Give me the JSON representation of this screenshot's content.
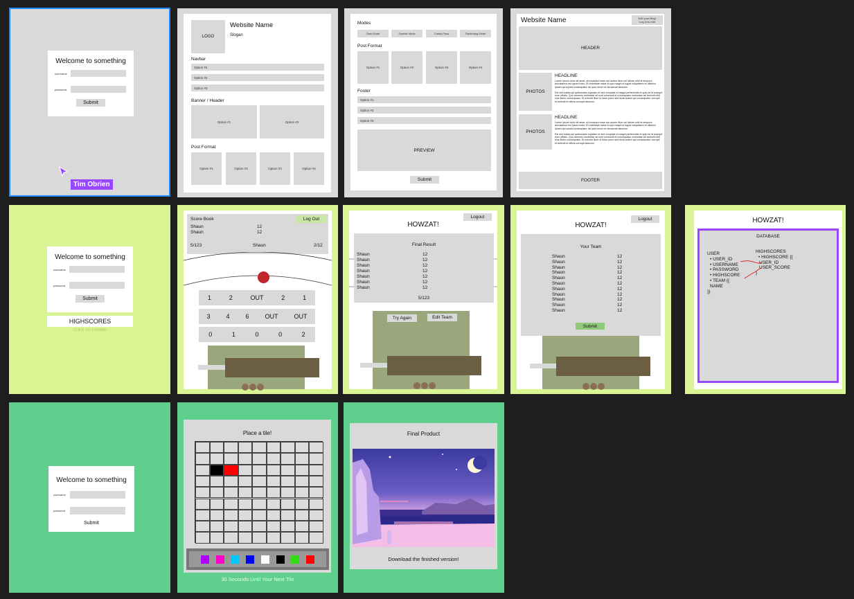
{
  "login": {
    "title": "Welcome to something",
    "username_label": "username",
    "password_label": "password",
    "submit": "Submit"
  },
  "cursor": {
    "user_name": "Tim Obrien",
    "tag_color": "#9747ff"
  },
  "builder": {
    "logo": "LOGO",
    "site_name": "Website Name",
    "slogan": "Slogan",
    "navbar_heading": "Navbar",
    "nav_options": [
      "Option #1",
      "Option #2",
      "Option #3"
    ],
    "banner_heading": "Banner / Header",
    "banner_options": [
      "Option #1",
      "Option #2"
    ],
    "post_heading": "Post Format",
    "post_options": [
      "Option #1",
      "Option #2",
      "Option #3",
      "Option #4"
    ]
  },
  "builder2": {
    "modes_heading": "Modes",
    "modes": [
      "Dark Mode",
      "Zombie Mode",
      "Candy Pass",
      "Flashbang Mode"
    ],
    "post_heading": "Post Format",
    "post_options": [
      "Option #1",
      "Option #2",
      "Option #3",
      "Option #4"
    ],
    "footer_heading": "Footer",
    "footer_options": [
      "Option #1",
      "Option #2",
      "Option #3"
    ],
    "preview": "PREVIEW",
    "submit": "Submit"
  },
  "website": {
    "name": "Website Name",
    "edit_line1": "Edit your Blog!",
    "edit_line2": "Log in to edit",
    "header": "HEADER",
    "photos": "PHOTOS",
    "headline": "HEADLINE",
    "paragraph1": "Lorem ipsum dolor sit amet, sit excepturi esse aut autem illum vel labore nihil et tempore accusamus est ipsum iusto. Et molestiae natus id quo magni ut fugiat voluptatem et ullamco ipsam qui soluta consequatur hic quis rerum et obcaecati laborum.",
    "paragraph2": "Est sint soluta qui quibusdam cupidam et sed voluptate et magni perferendis et quis ea id suscipit eum officiis. Quo cimenes molestiae sit sunt commodi et consequatur molestiae vel deleniti nihil eius libero consequatur. Et eveniet illum id dolor porro sed dicta autem qui consequatur corrupti et deleniti et officia corrupti laborum.",
    "footer": "FOOTER"
  },
  "highscores": {
    "label": "HIGHSCORES",
    "expand": "CLICK TO EXPAND"
  },
  "scorebook": {
    "title": "Score Book",
    "logout": "Log Out",
    "players": [
      {
        "name": "Shaun",
        "score": "12"
      },
      {
        "name": "Shaun",
        "score": "12"
      }
    ],
    "overs": "5/123",
    "batter": "Shaun",
    "wickets": "2/12",
    "grid": [
      [
        "1",
        "2",
        "OUT",
        "2",
        "1"
      ],
      [
        "3",
        "4",
        "6",
        "OUT",
        "OUT"
      ],
      [
        "0",
        "1",
        "0",
        "0",
        "2"
      ]
    ]
  },
  "result": {
    "app_title": "HOWZAT!",
    "logout": "Logout",
    "heading": "Final Result",
    "rows": [
      {
        "name": "Shaun",
        "score": "12"
      },
      {
        "name": "Shaun",
        "score": "12"
      },
      {
        "name": "Shaun",
        "score": "12"
      },
      {
        "name": "Shaun",
        "score": "12"
      },
      {
        "name": "Shaun",
        "score": "12"
      },
      {
        "name": "Shaun",
        "score": "12"
      },
      {
        "name": "Shaun",
        "score": "12"
      }
    ],
    "total": "5/123",
    "try_again": "Try Again",
    "edit_team": "Edit Team"
  },
  "team": {
    "app_title": "HOWZAT!",
    "logout": "Logout",
    "heading": "Your Team",
    "rows": [
      {
        "name": "Shaun",
        "score": "12"
      },
      {
        "name": "Shaun",
        "score": "12"
      },
      {
        "name": "Shaun",
        "score": "12"
      },
      {
        "name": "Shaun",
        "score": "12"
      },
      {
        "name": "Shaun",
        "score": "12"
      },
      {
        "name": "Shaun",
        "score": "12"
      },
      {
        "name": "Shaun",
        "score": "12"
      },
      {
        "name": "Shaun",
        "score": "12"
      },
      {
        "name": "Shaun",
        "score": "12"
      },
      {
        "name": "Shaun",
        "score": "12"
      },
      {
        "name": "Shaun",
        "score": "12"
      }
    ],
    "submit": "Submit",
    "submit_color": "#8fc97a"
  },
  "database": {
    "app_title": "HOWZAT!",
    "heading": "DATABASE",
    "user": "USER",
    "user_fields": [
      "USER_ID",
      "USERNAME",
      "PASSWORD",
      "HIGHSCORE",
      "TEAM {{"
    ],
    "user_name_line": "NAME",
    "user_close": "}}",
    "highscores": "HIGHSCORES",
    "hs_fields": [
      "HIGHSCORE {{"
    ],
    "hs_sub": [
      "USER_ID",
      "USER_SCORE"
    ],
    "hs_close": "}",
    "border_color": "#9747ff"
  },
  "tile": {
    "title": "Place a tile!",
    "palette": [
      "#b000ff",
      "#ff00c8",
      "#00c8ff",
      "#0000ff",
      "#ffffff",
      "#000000",
      "#33dd11",
      "#ff0000"
    ],
    "timer": "30 Seconds Until Your Next Tile"
  },
  "final": {
    "title": "Final Product",
    "download": "Download the finished version!"
  },
  "colors": {
    "canvas": "#1e1e1e",
    "lime": "#d9f593",
    "green": "#5ecf8c",
    "selection": "#1e8cff"
  }
}
